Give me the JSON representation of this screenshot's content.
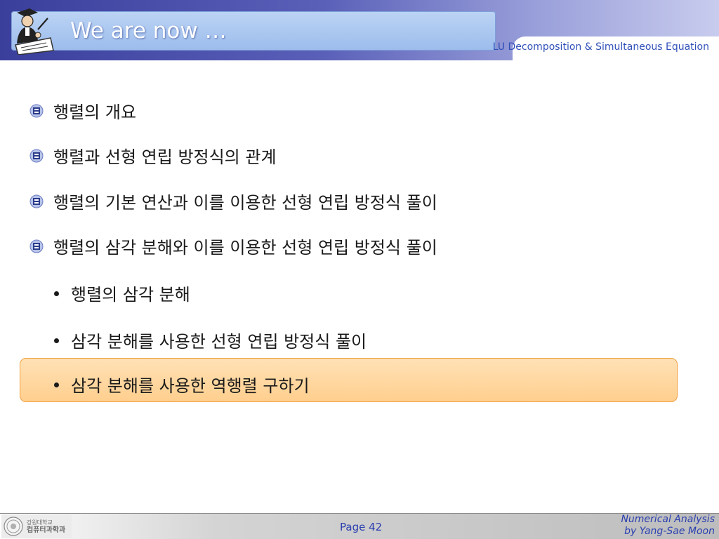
{
  "header": {
    "title": "We are now …",
    "subtitle": "LU Decomposition & Simultaneous Equation"
  },
  "items": [
    {
      "text": "행렬의 개요"
    },
    {
      "text": "행렬과 선형 연립 방정식의 관계"
    },
    {
      "text": "행렬의 기본 연산과 이를 이용한 선형 연립 방정식 풀이"
    },
    {
      "text": "행렬의 삼각 분해와 이를 이용한 선형 연립 방정식 풀이"
    }
  ],
  "subitems": [
    {
      "text": "행렬의 삼각 분해"
    },
    {
      "text": "삼각 분해를 사용한 선형 연립 방정식 풀이"
    },
    {
      "text": "삼각 분해를 사용한 역행렬 구하기",
      "highlighted": true
    }
  ],
  "colors": {
    "accent": "#3a3f9c",
    "highlight_fill": "#ffd9a3",
    "highlight_border": "#f2a040",
    "footer_text": "#2a3fb0"
  },
  "footer": {
    "univ_line1": "강원대학교",
    "univ_line2": "컴퓨터과학과",
    "page": "Page 42",
    "course_line1": "Numerical Analysis",
    "course_line2": "by Yang-Sae Moon"
  }
}
